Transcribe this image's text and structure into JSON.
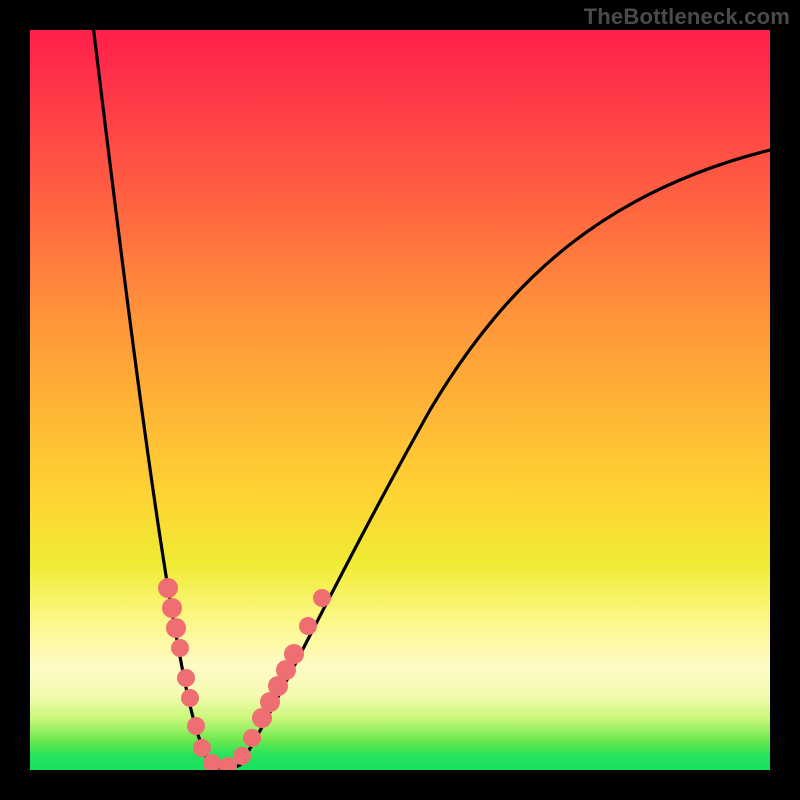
{
  "watermark": "TheBottleneck.com",
  "colors": {
    "frame": "#000000",
    "gradient_top": "#ff1f4b",
    "gradient_mid_orange": "#ff8f3b",
    "gradient_yellow": "#ffd133",
    "gradient_pale": "#fffbc5",
    "gradient_green": "#17e160",
    "curve_stroke": "#000000",
    "dot_fill": "#ee6e72",
    "watermark_text": "#4a4a4a"
  },
  "chart_data": {
    "type": "line",
    "title": "",
    "xlabel": "",
    "ylabel": "",
    "xlim": [
      0,
      100
    ],
    "ylim": [
      0,
      100
    ],
    "note": "Axes are unlabeled in the image; x/y are normalized 0–100 to the plot area. y=0 is the bottom (green) edge; higher y = higher up (more red). Values estimated from pixel positions.",
    "series": [
      {
        "name": "bottleneck-curve",
        "x": [
          8,
          12,
          16,
          19,
          22,
          24,
          26,
          28,
          32,
          38,
          46,
          54,
          65,
          80,
          100
        ],
        "y": [
          104,
          70,
          45,
          23,
          8,
          1,
          0.5,
          1,
          10,
          30,
          49,
          62,
          74,
          82,
          84
        ]
      }
    ],
    "markers": {
      "name": "highlight-dots",
      "color": "#ee6e72",
      "points_x": [
        18.6,
        19.2,
        19.7,
        20.3,
        21.1,
        21.6,
        22.4,
        23.2,
        24.6,
        26.8,
        28.6,
        30.0,
        31.4,
        32.4,
        33.5,
        34.6,
        35.7,
        37.6,
        39.5
      ],
      "points_y": [
        24.6,
        21.9,
        19.2,
        16.5,
        12.4,
        9.7,
        5.9,
        3.0,
        1.0,
        0.5,
        1.9,
        4.3,
        7.0,
        9.2,
        11.4,
        13.5,
        15.7,
        19.5,
        23.2
      ]
    },
    "background_gradient": {
      "direction": "vertical",
      "stops": [
        {
          "pos": 0.0,
          "color": "#ff1f4b"
        },
        {
          "pos": 0.1,
          "color": "#ff3b47"
        },
        {
          "pos": 0.25,
          "color": "#ff6840"
        },
        {
          "pos": 0.37,
          "color": "#ff8f3b"
        },
        {
          "pos": 0.5,
          "color": "#ffb236"
        },
        {
          "pos": 0.62,
          "color": "#ffd133"
        },
        {
          "pos": 0.72,
          "color": "#f0eb33"
        },
        {
          "pos": 0.8,
          "color": "#fcf88a"
        },
        {
          "pos": 0.86,
          "color": "#fffbc5"
        },
        {
          "pos": 0.9,
          "color": "#f4fbb0"
        },
        {
          "pos": 0.93,
          "color": "#c9f77a"
        },
        {
          "pos": 0.96,
          "color": "#6de84f"
        },
        {
          "pos": 0.98,
          "color": "#26e35a"
        },
        {
          "pos": 1.0,
          "color": "#17e160"
        }
      ]
    }
  }
}
